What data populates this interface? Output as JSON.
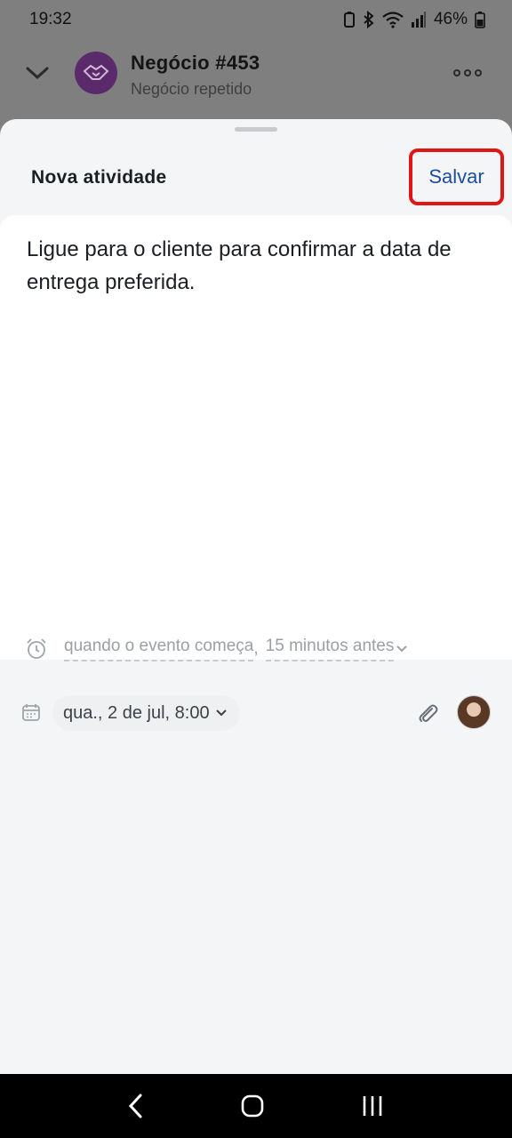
{
  "status_bar": {
    "time": "19:32",
    "battery": "46%",
    "icons": [
      "battery-saver-icon",
      "bluetooth-icon",
      "wifi-icon",
      "signal-icon",
      "battery-icon"
    ]
  },
  "deal": {
    "title": "Negócio #453",
    "subtitle": "Negócio repetido",
    "icon": "handshake-icon"
  },
  "sheet": {
    "title": "Nova atividade",
    "save_label": "Salvar",
    "note": "Ligue para o cliente para confirmar a data de entrega preferida.",
    "reminder": {
      "when": "quando o evento começa",
      "separator": ",",
      "offset": "15 minutos antes"
    },
    "date_label": "qua., 2 de jul, 8:00"
  },
  "colors": {
    "accent": "#1b4e9b",
    "highlight": "#e01616",
    "sheet_bg": "#f4f5f7",
    "dim": "#7f7f7f"
  }
}
